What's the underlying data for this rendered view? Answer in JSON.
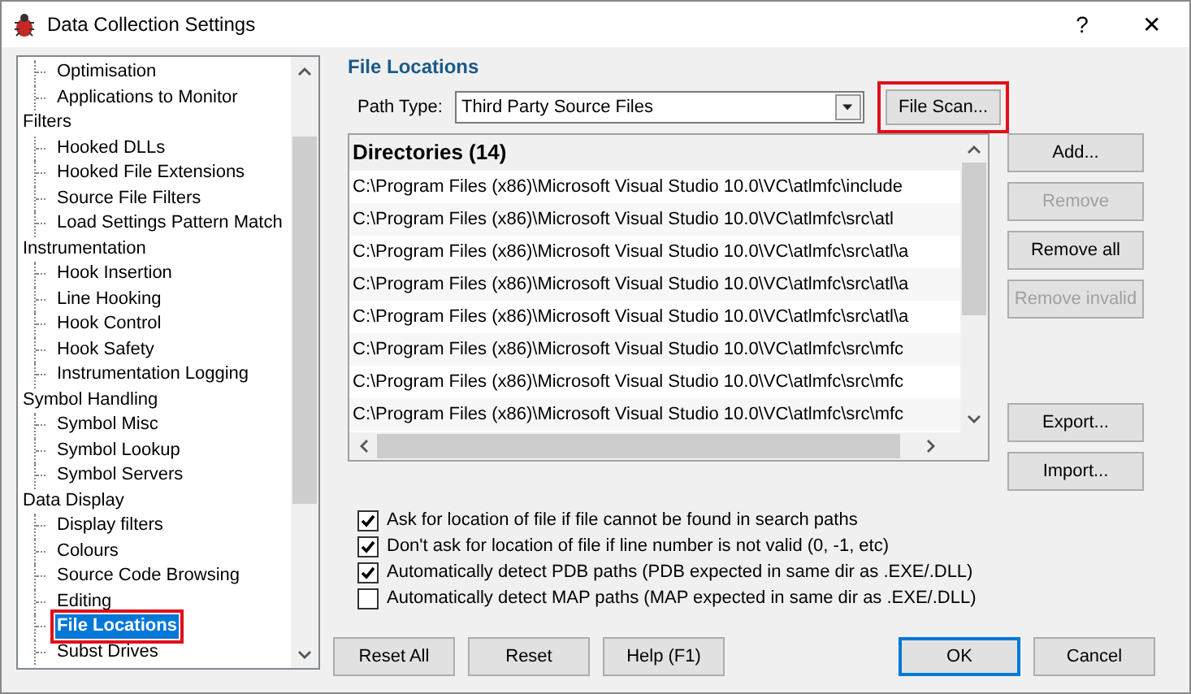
{
  "window": {
    "title": "Data Collection Settings",
    "help": "?",
    "close": "✕"
  },
  "tree": [
    {
      "children": [
        {
          "label": "Optimisation",
          "selected": false
        },
        {
          "label": "Applications to Monitor",
          "selected": false
        }
      ]
    },
    {
      "label": "Filters",
      "children": [
        {
          "label": "Hooked DLLs",
          "selected": false
        },
        {
          "label": "Hooked File Extensions",
          "selected": false
        },
        {
          "label": "Source File Filters",
          "selected": false
        },
        {
          "label": "Load Settings Pattern Match",
          "selected": false
        }
      ]
    },
    {
      "label": "Instrumentation",
      "children": [
        {
          "label": "Hook Insertion",
          "selected": false
        },
        {
          "label": "Line Hooking",
          "selected": false
        },
        {
          "label": "Hook Control",
          "selected": false
        },
        {
          "label": "Hook Safety",
          "selected": false
        },
        {
          "label": "Instrumentation Logging",
          "selected": false
        }
      ]
    },
    {
      "label": "Symbol Handling",
      "children": [
        {
          "label": "Symbol Misc",
          "selected": false
        },
        {
          "label": "Symbol Lookup",
          "selected": false
        },
        {
          "label": "Symbol Servers",
          "selected": false
        }
      ]
    },
    {
      "label": "Data Display",
      "children": [
        {
          "label": "Display filters",
          "selected": false
        },
        {
          "label": "Colours",
          "selected": false
        },
        {
          "label": "Source Code Browsing",
          "selected": false
        },
        {
          "label": "Editing",
          "selected": false
        },
        {
          "label": "File Locations",
          "selected": true
        },
        {
          "label": "Subst Drives",
          "selected": false
        }
      ]
    }
  ],
  "section_title": "File Locations",
  "path_type": {
    "label": "Path Type:",
    "value": "Third Party Source Files"
  },
  "file_scan": {
    "label": "File Scan...",
    "highlighted": true
  },
  "directories": {
    "header": "Directories (14)",
    "rows": [
      "C:\\Program Files (x86)\\Microsoft Visual Studio 10.0\\VC\\atlmfc\\include",
      "C:\\Program Files (x86)\\Microsoft Visual Studio 10.0\\VC\\atlmfc\\src\\atl",
      "C:\\Program Files (x86)\\Microsoft Visual Studio 10.0\\VC\\atlmfc\\src\\atl\\a",
      "C:\\Program Files (x86)\\Microsoft Visual Studio 10.0\\VC\\atlmfc\\src\\atl\\a",
      "C:\\Program Files (x86)\\Microsoft Visual Studio 10.0\\VC\\atlmfc\\src\\atl\\a",
      "C:\\Program Files (x86)\\Microsoft Visual Studio 10.0\\VC\\atlmfc\\src\\mfc",
      "C:\\Program Files (x86)\\Microsoft Visual Studio 10.0\\VC\\atlmfc\\src\\mfc",
      "C:\\Program Files (x86)\\Microsoft Visual Studio 10.0\\VC\\atlmfc\\src\\mfc"
    ]
  },
  "side_buttons": [
    {
      "label": "Add...",
      "disabled": false
    },
    {
      "label": "Remove",
      "disabled": true
    },
    {
      "label": "Remove all",
      "disabled": false
    },
    {
      "label": "Remove invalid",
      "disabled": true
    }
  ],
  "io_buttons": [
    {
      "label": "Export...",
      "disabled": false
    },
    {
      "label": "Import...",
      "disabled": false
    }
  ],
  "options": [
    {
      "label": "Ask for location of file if file cannot be found in search paths",
      "checked": true
    },
    {
      "label": "Don't ask for location of file if line number is not valid (0, -1, etc)",
      "checked": true
    },
    {
      "label": "Automatically detect PDB paths (PDB expected in same dir as .EXE/.DLL)",
      "checked": true
    },
    {
      "label": "Automatically detect MAP paths (MAP expected in same dir as .EXE/.DLL)",
      "checked": false
    }
  ],
  "bottom_buttons": [
    {
      "label": "Reset All",
      "default": false
    },
    {
      "label": "Reset",
      "default": false
    },
    {
      "label": "Help (F1)",
      "default": false
    }
  ],
  "dialog_buttons": [
    {
      "label": "OK",
      "default": true
    },
    {
      "label": "Cancel",
      "default": false
    }
  ]
}
